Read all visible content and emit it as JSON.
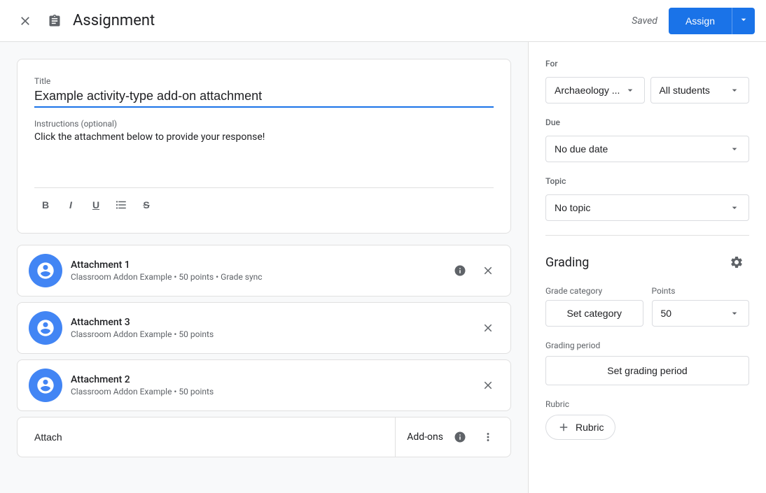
{
  "header": {
    "title": "Assignment",
    "saved_text": "Saved",
    "assign_label": "Assign"
  },
  "form": {
    "title_label": "Title",
    "title_value": "Example activity-type add-on attachment",
    "instructions_label": "Instructions (optional)",
    "instructions_value": "Click the attachment below to provide your response!"
  },
  "attachments": [
    {
      "name": "Attachment 1",
      "subtitle": "Classroom Addon Example • 50 points • Grade sync"
    },
    {
      "name": "Attachment 3",
      "subtitle": "Classroom Addon Example • 50 points"
    },
    {
      "name": "Attachment 2",
      "subtitle": "Classroom Addon Example • 50 points"
    }
  ],
  "bottom_bar": {
    "attach_label": "Attach",
    "addons_label": "Add-ons"
  },
  "right_panel": {
    "for_label": "For",
    "class_value": "Archaeology ...",
    "students_value": "All students",
    "due_label": "Due",
    "due_value": "No due date",
    "topic_label": "Topic",
    "topic_value": "No topic",
    "grading_title": "Grading",
    "grade_category_label": "Grade category",
    "points_label": "Points",
    "set_category_label": "Set category",
    "points_value": "50",
    "grading_period_label": "Grading period",
    "set_grading_period_label": "Set grading period",
    "rubric_label": "Rubric",
    "add_rubric_label": "Rubric"
  }
}
